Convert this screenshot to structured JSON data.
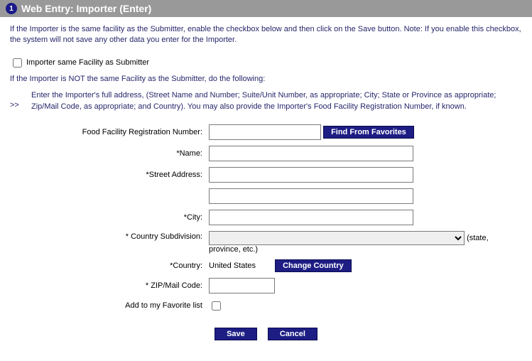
{
  "header": {
    "step": "1",
    "title": "Web Entry: Importer (Enter)"
  },
  "intro": "If the Importer is the same facility as the Submitter, enable the checkbox below and then click on the Save button. Note: If you enable this checkbox, the system will not save any other data you enter for the Importer.",
  "sameFacility": {
    "label": "Importer same Facility as Submitter",
    "checked": false
  },
  "notSameIntro": "If the Importer is NOT the same Facility as the Submitter, do the following:",
  "indentMarker": ">>",
  "indentText": "Enter the Importer's full address, (Street Name and Number; Suite/Unit Number, as appropriate; City; State or Province as appropriate; Zip/Mail Code, as appropriate; and Country). You may also provide the Importer's Food Facility Registration Number, if known.",
  "form": {
    "ffrn": {
      "label": "Food Facility Registration Number:",
      "value": "",
      "button": "Find From Favorites"
    },
    "name": {
      "label": "*Name:",
      "value": ""
    },
    "street": {
      "label": "*Street Address:",
      "value": ""
    },
    "street2": {
      "label": "",
      "value": ""
    },
    "city": {
      "label": "*City:",
      "value": ""
    },
    "subdivision": {
      "label": "* Country Subdivision:",
      "hint": "(state, province, etc.)",
      "value": ""
    },
    "country": {
      "label": "*Country:",
      "value": "United States",
      "button": "Change Country"
    },
    "zip": {
      "label": "* ZIP/Mail Code:",
      "value": ""
    },
    "favorite": {
      "label": "Add to my Favorite list",
      "checked": false
    }
  },
  "buttons": {
    "save": "Save",
    "cancel": "Cancel"
  }
}
